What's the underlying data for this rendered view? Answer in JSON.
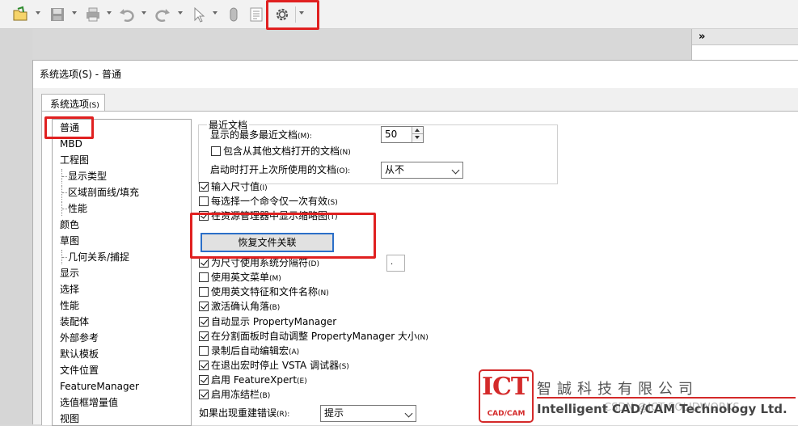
{
  "colors": {
    "highlight": "#e02020",
    "button_focus": "#2b6fc8",
    "logo_red": "#d42a2a"
  },
  "toolbar": {
    "icons": [
      "new-doc-icon",
      "open-icon",
      "save-icon",
      "print-icon",
      "undo-icon",
      "redo-icon",
      "select-icon",
      "rebuild-icon",
      "file-properties-icon",
      "options-gear-icon"
    ]
  },
  "right_pane": {
    "collapse_label": "»"
  },
  "dialog": {
    "title": "系统选项(S) - 普通",
    "tab": {
      "label": "系统选项",
      "hotkey": "(S)"
    }
  },
  "tree": {
    "items": [
      {
        "label": "普通",
        "child": false
      },
      {
        "label": "MBD",
        "child": false
      },
      {
        "label": "工程图",
        "child": false
      },
      {
        "label": "显示类型",
        "child": true
      },
      {
        "label": "区域剖面线/填充",
        "child": true
      },
      {
        "label": "性能",
        "child": true
      },
      {
        "label": "颜色",
        "child": false
      },
      {
        "label": "草图",
        "child": false
      },
      {
        "label": "几何关系/捕捉",
        "child": true
      },
      {
        "label": "显示",
        "child": false
      },
      {
        "label": "选择",
        "child": false
      },
      {
        "label": "性能",
        "child": false
      },
      {
        "label": "装配体",
        "child": false
      },
      {
        "label": "外部参考",
        "child": false
      },
      {
        "label": "默认模板",
        "child": false
      },
      {
        "label": "文件位置",
        "child": false
      },
      {
        "label": "FeatureManager",
        "child": false
      },
      {
        "label": "选值框增量值",
        "child": false
      },
      {
        "label": "视图",
        "child": false
      }
    ]
  },
  "recent": {
    "group_title": "最近文档",
    "max_label": "显示的最多最近文档",
    "max_hotkey": "(M):",
    "max_value": "50",
    "include_label": "包含从其他文档打开的文档",
    "include_hotkey": "(N)",
    "include_checked": false,
    "startup_label": "启动时打开上次所使用的文档",
    "startup_hotkey": "(O):",
    "startup_value": "从不"
  },
  "options": [
    {
      "label": "输入尺寸值",
      "hotkey": "(I)",
      "checked": true
    },
    {
      "label": "每选择一个命令仅一次有效",
      "hotkey": "(S)",
      "checked": false
    },
    {
      "label": "在资源管理器中显示缩略图",
      "hotkey": "(T)",
      "checked": true
    },
    {
      "label": "为尺寸使用系统分隔符",
      "hotkey": "(D)",
      "checked": true
    },
    {
      "label": "使用英文菜单",
      "hotkey": "(M)",
      "checked": false
    },
    {
      "label": "使用英文特征和文件名称",
      "hotkey": "(N)",
      "checked": false
    },
    {
      "label": "激活确认角落",
      "hotkey": "(B)",
      "checked": true
    },
    {
      "label": "自动显示 PropertyManager",
      "hotkey": "",
      "checked": true
    },
    {
      "label": "在分割面板时自动调整 PropertyManager 大小",
      "hotkey": "(N)",
      "checked": true
    },
    {
      "label": "录制后自动编辑宏",
      "hotkey": "(A)",
      "checked": false
    },
    {
      "label": "在退出宏时停止 VSTA 调试器",
      "hotkey": "(S)",
      "checked": true
    },
    {
      "label": "启用 FeatureXpert",
      "hotkey": "(E)",
      "checked": true
    },
    {
      "label": "启用冻结栏",
      "hotkey": "(B)",
      "checked": true
    }
  ],
  "restore_button": "恢复文件关联",
  "separator_value": ".",
  "rebuild_error": {
    "label": "如果出现重建错误",
    "hotkey": "(R):",
    "value": "提示"
  },
  "watermark": {
    "logo": "ICT",
    "logo_sub": "CAD/CAM",
    "company_cn": "智誠科技有限公司",
    "company_en": "Intelligent CAD/CAM Technology Ltd.",
    "csdn": "CSDN @ICT SOLIDWORKS"
  }
}
